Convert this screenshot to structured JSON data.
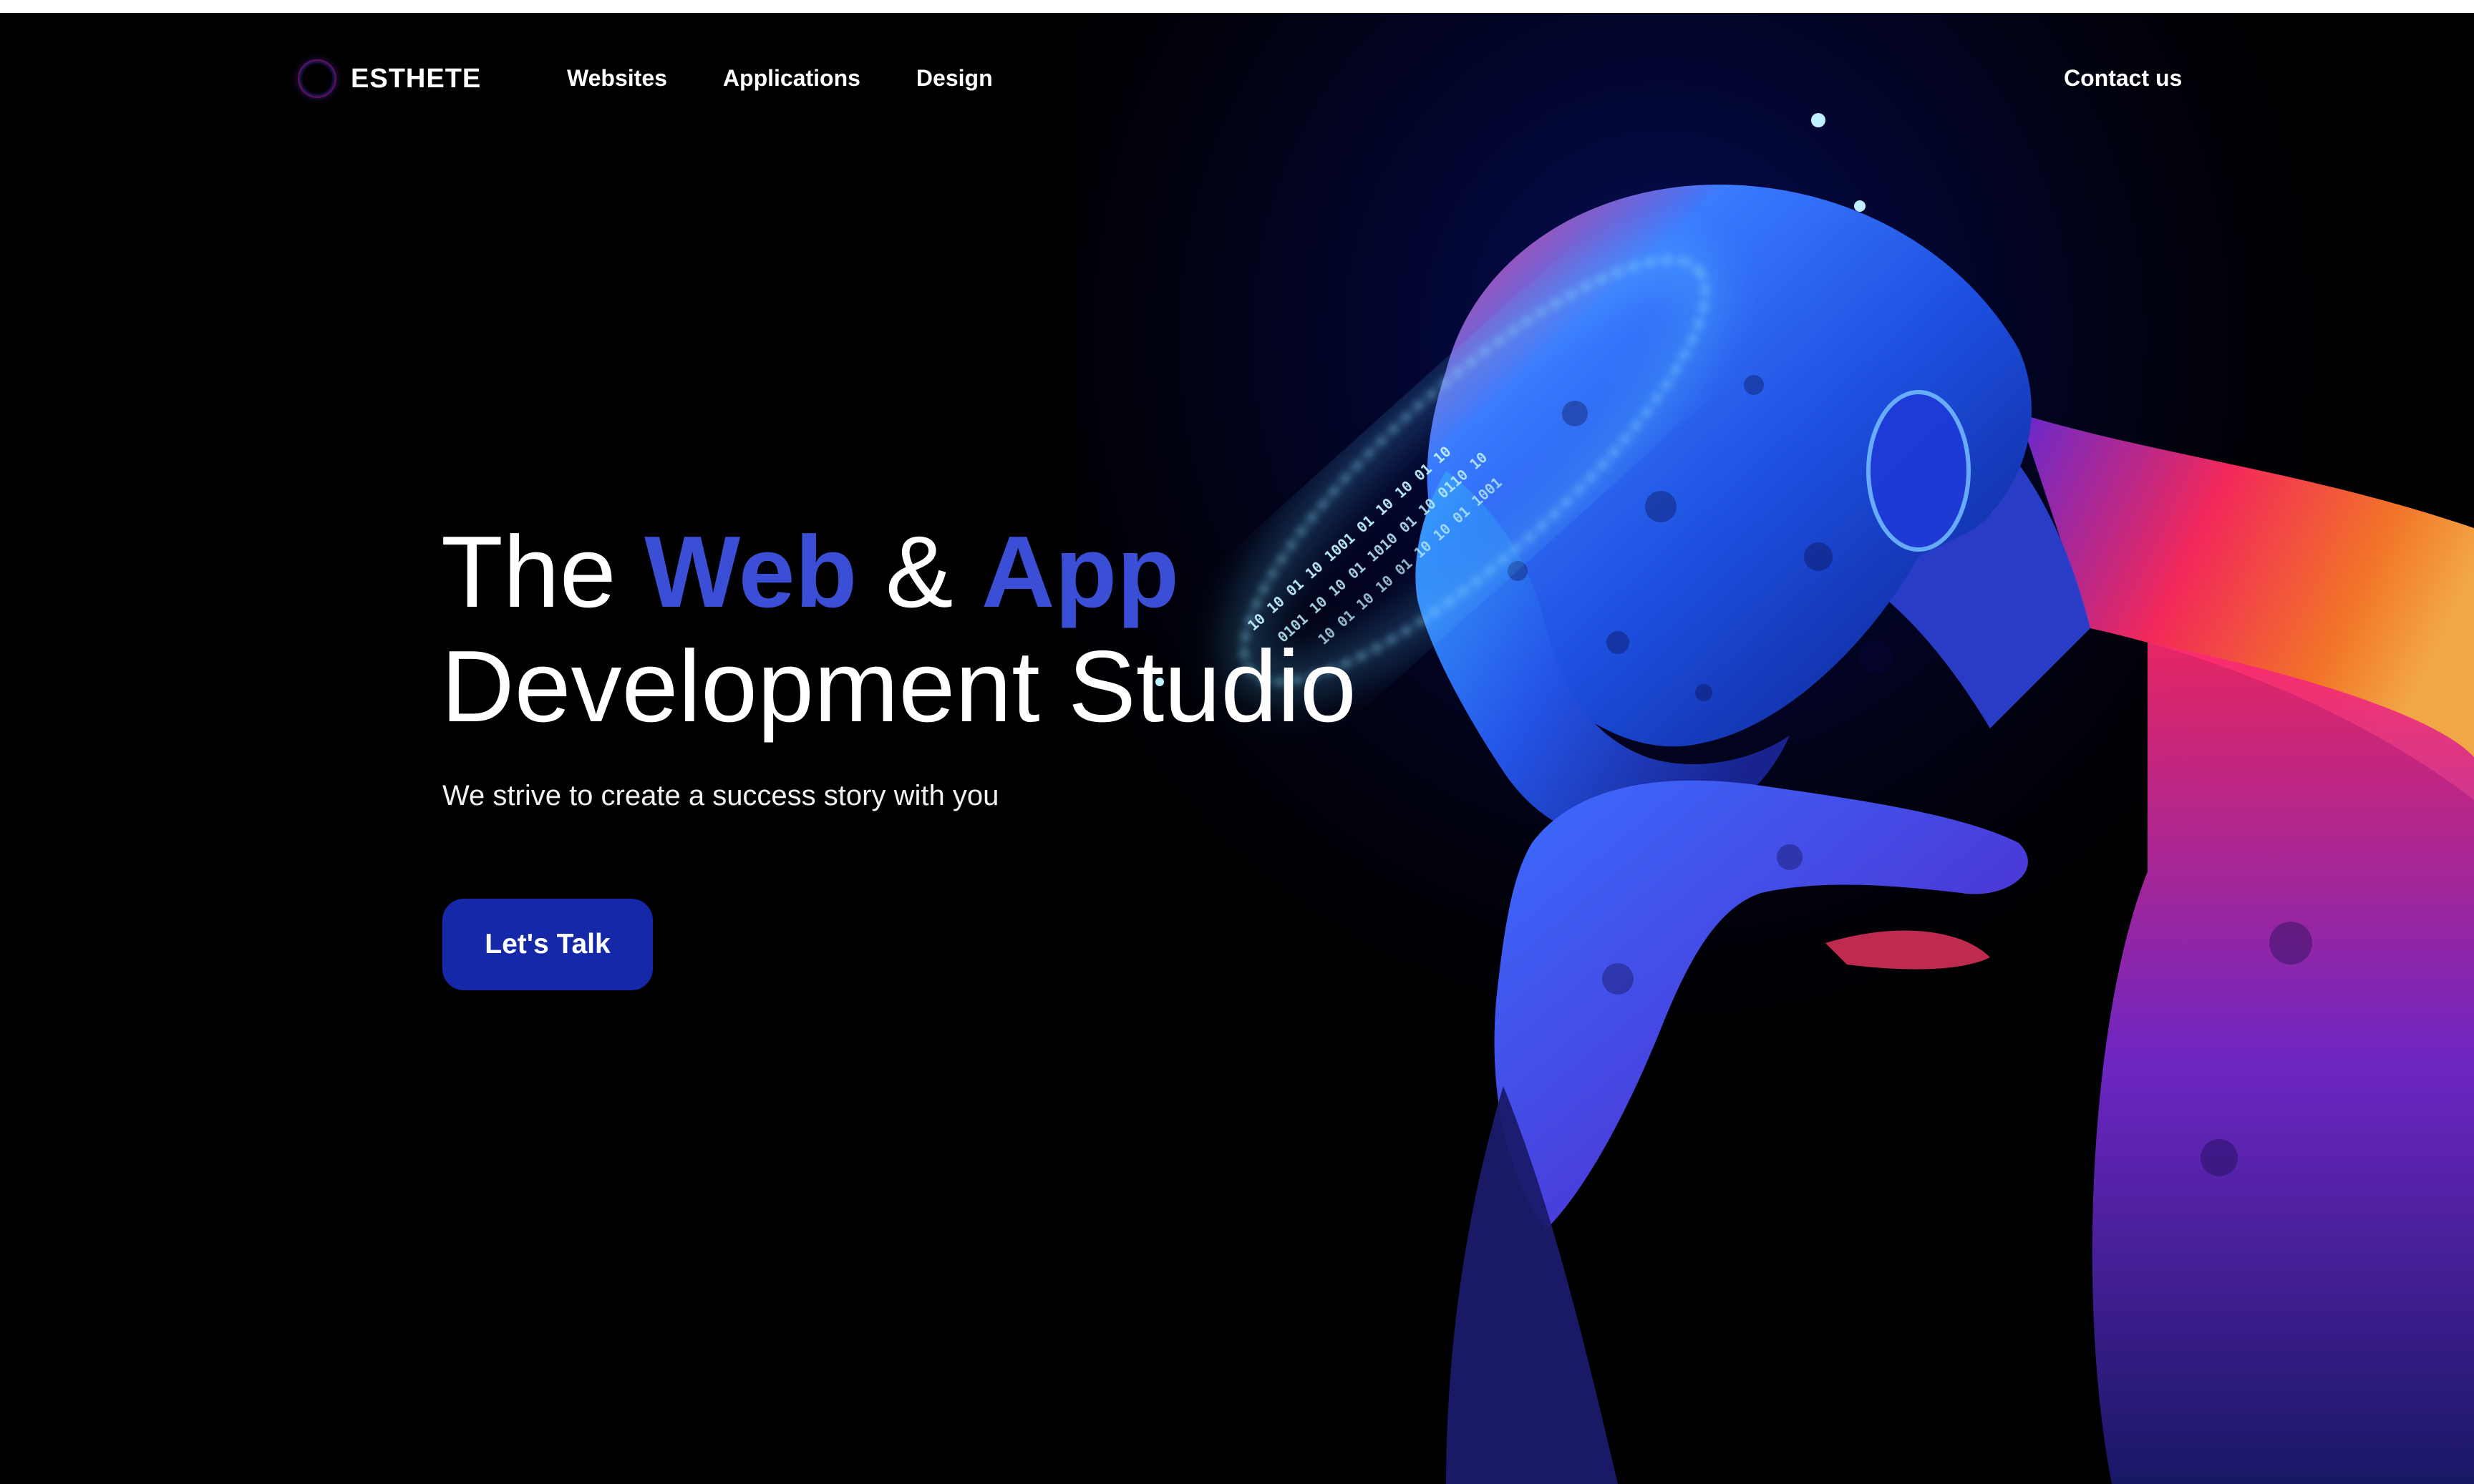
{
  "brand": {
    "name": "ESTHETE",
    "mark_icon": "ring-logo-icon"
  },
  "nav": {
    "items": [
      {
        "label": "Websites"
      },
      {
        "label": "Applications"
      },
      {
        "label": "Design"
      }
    ],
    "contact_label": "Contact us"
  },
  "hero": {
    "headline": {
      "the": "The",
      "web": "Web",
      "amp": "&",
      "app": "App",
      "line2": "Development Studio"
    },
    "subtitle": "We strive to create a success story with you",
    "cta_label": "Let's Talk",
    "image_icon": "thinker-statue-binary-halo-image"
  },
  "colors": {
    "background": "#000000",
    "accent": "#3a4fd6",
    "cta_background": "#1428a8",
    "text": "#ffffff",
    "art_blue": "#2a6cff",
    "art_magenta": "#ff1f6a",
    "art_orange": "#ff8a2a"
  }
}
